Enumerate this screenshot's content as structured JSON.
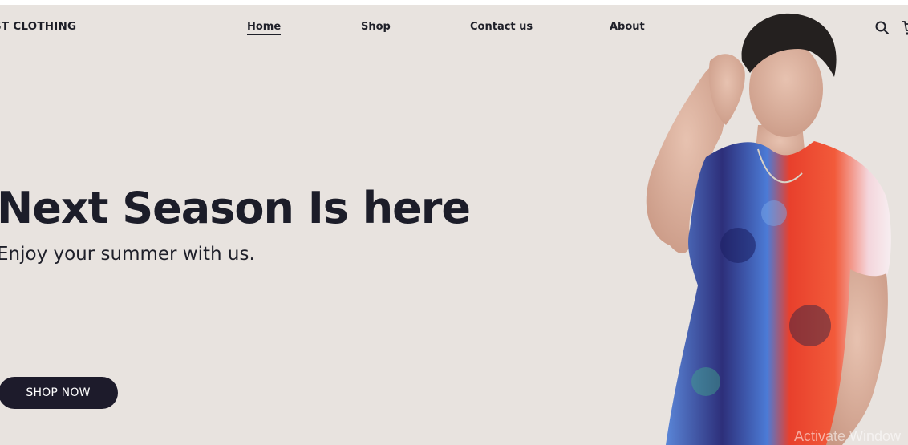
{
  "brand": {
    "name": "ST CLOTHING"
  },
  "nav": {
    "items": [
      {
        "label": "Home"
      },
      {
        "label": "Shop"
      },
      {
        "label": "Contact us"
      },
      {
        "label": "About"
      }
    ],
    "active": "Home"
  },
  "icons": {
    "search": "search-icon",
    "cart": "cart-icon"
  },
  "hero": {
    "headline": "Next Season Is here",
    "subline": "Enjoy your summer with us.",
    "cta_label": "SHOP NOW"
  },
  "watermark": {
    "text": "Activate Window"
  },
  "colors": {
    "background": "#e8e3df",
    "text_dark": "#1c1d29",
    "button": "#1d1b2b",
    "button_text": "#ffffff",
    "shirt_red": "#ef3b2a",
    "shirt_blue": "#3a62c8"
  }
}
